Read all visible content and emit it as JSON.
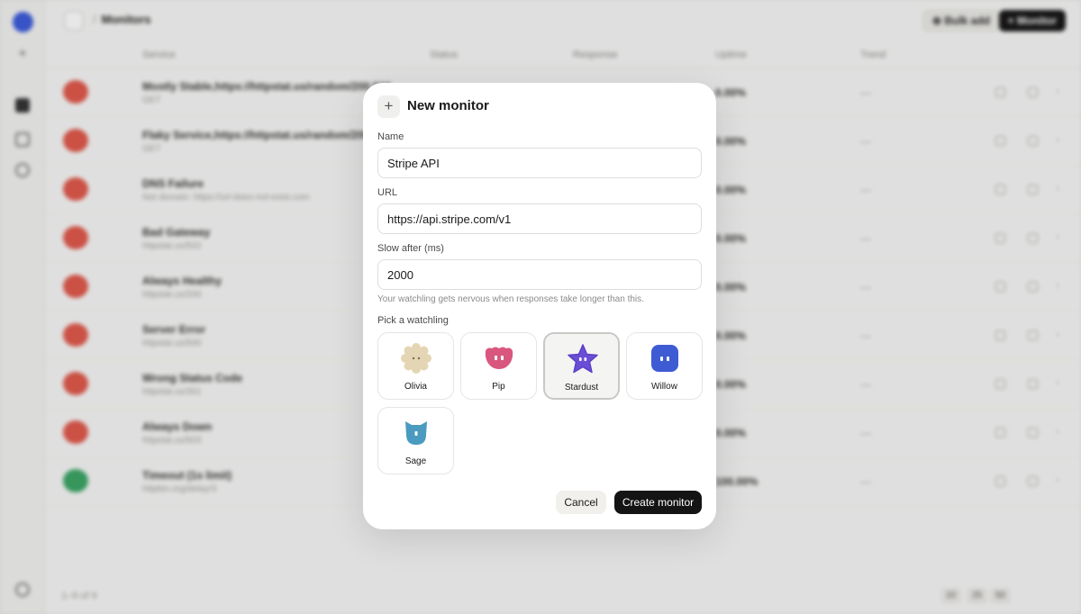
{
  "background": {
    "breadcrumb": "Monitors",
    "bulk_add_label": "Bulk add",
    "new_monitor_label": "Monitor",
    "table_headers": [
      "Service",
      "Status",
      "Response",
      "Uptime",
      "Trend"
    ],
    "rows": [
      {
        "name": "Mostly Stable,https://httpstat.us/random/200,503",
        "sub": "GET",
        "uptime": "0.00%",
        "trend": "—",
        "color": "#e0584b"
      },
      {
        "name": "Flaky Service,https://httpstat.us/random/200,500",
        "sub": "GET",
        "uptime": "0.00%",
        "trend": "—",
        "color": "#e0584b"
      },
      {
        "name": "DNS Failure",
        "sub": "Not domain: https://url-does-not-exist.com",
        "uptime": "0.00%",
        "trend": "—",
        "color": "#e0584b"
      },
      {
        "name": "Bad Gateway",
        "sub": "httpstat.us/502",
        "uptime": "0.00%",
        "trend": "—",
        "color": "#e0584b"
      },
      {
        "name": "Always Healthy",
        "sub": "httpstat.us/200",
        "uptime": "0.00%",
        "trend": "—",
        "color": "#e0584b"
      },
      {
        "name": "Server Error",
        "sub": "httpstat.us/500",
        "uptime": "0.00%",
        "trend": "—",
        "color": "#e0584b"
      },
      {
        "name": "Wrong Status Code",
        "sub": "httpstat.us/301",
        "uptime": "0.00%",
        "trend": "—",
        "color": "#e0584b"
      },
      {
        "name": "Always Down",
        "sub": "httpstat.us/503",
        "uptime": "0.00%",
        "trend": "—",
        "color": "#e0584b"
      },
      {
        "name": "Timeout (1s limit)",
        "sub": "httpbin.org/delay/3",
        "uptime": "100.00%",
        "trend": "—",
        "color": "#3aa565"
      }
    ],
    "footer_count": "1–9 of 9",
    "page_sizes": [
      "10",
      "25",
      "50"
    ]
  },
  "modal": {
    "title": "New monitor",
    "name_label": "Name",
    "name_value": "Stripe API",
    "url_label": "URL",
    "url_value": "https://api.stripe.com/v1",
    "slow_label": "Slow after (ms)",
    "slow_value": "2000",
    "hint": "Your watchling gets nervous when responses take longer than this.",
    "pick_label": "Pick a watchling",
    "watchlings": [
      {
        "name": "Olivia",
        "icon": "olivia-flower-icon",
        "color": "#e2d3b0",
        "selected": false
      },
      {
        "name": "Pip",
        "icon": "pip-blob-icon",
        "color": "#d9577e",
        "selected": false
      },
      {
        "name": "Stardust",
        "icon": "stardust-star-icon",
        "color": "#6a4fd6",
        "selected": true
      },
      {
        "name": "Willow",
        "icon": "willow-cube-icon",
        "color": "#3e5bd4",
        "selected": false
      },
      {
        "name": "Sage",
        "icon": "sage-cat-icon",
        "color": "#4a9bbf",
        "selected": false
      }
    ],
    "cancel_label": "Cancel",
    "create_label": "Create monitor"
  }
}
